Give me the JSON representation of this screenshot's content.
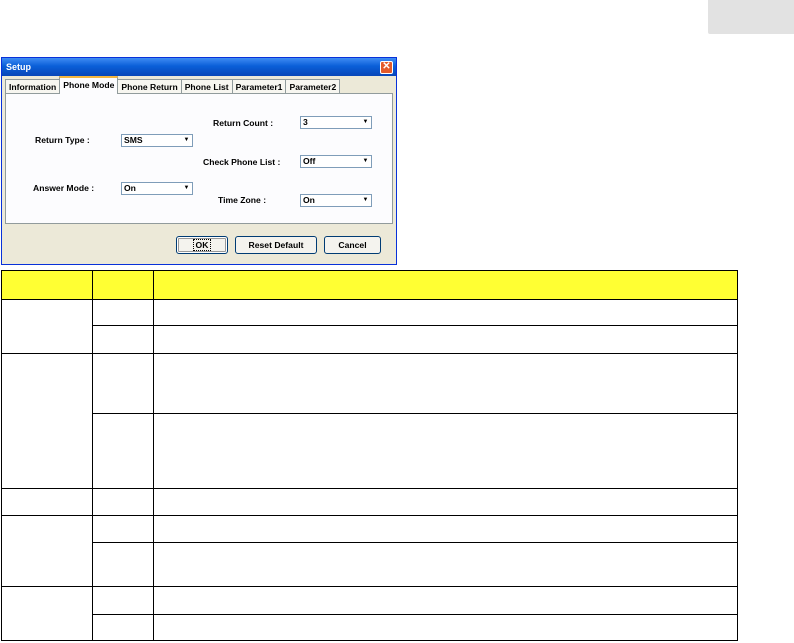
{
  "dialog": {
    "title": "Setup",
    "close_icon": "close-icon",
    "tabs": [
      {
        "label": "Information",
        "active": false
      },
      {
        "label": "Phone Mode",
        "active": true
      },
      {
        "label": "Phone Return",
        "active": false
      },
      {
        "label": "Phone List",
        "active": false
      },
      {
        "label": "Parameter1",
        "active": false
      },
      {
        "label": "Parameter2",
        "active": false
      }
    ],
    "fields": {
      "return_type": {
        "label": "Return Type :",
        "value": "SMS"
      },
      "answer_mode": {
        "label": "Answer Mode :",
        "value": "On"
      },
      "return_count": {
        "label": "Return Count :",
        "value": "3"
      },
      "check_phone_list": {
        "label": "Check Phone List :",
        "value": "Off"
      },
      "time_zone": {
        "label": "Time Zone :",
        "value": "On"
      }
    },
    "buttons": {
      "ok": "OK",
      "reset_default": "Reset Default",
      "cancel": "Cancel"
    }
  },
  "colors": {
    "table_header": "#ffff33",
    "titlebar": "#0a5fd8",
    "close_button": "#e35a2a"
  }
}
